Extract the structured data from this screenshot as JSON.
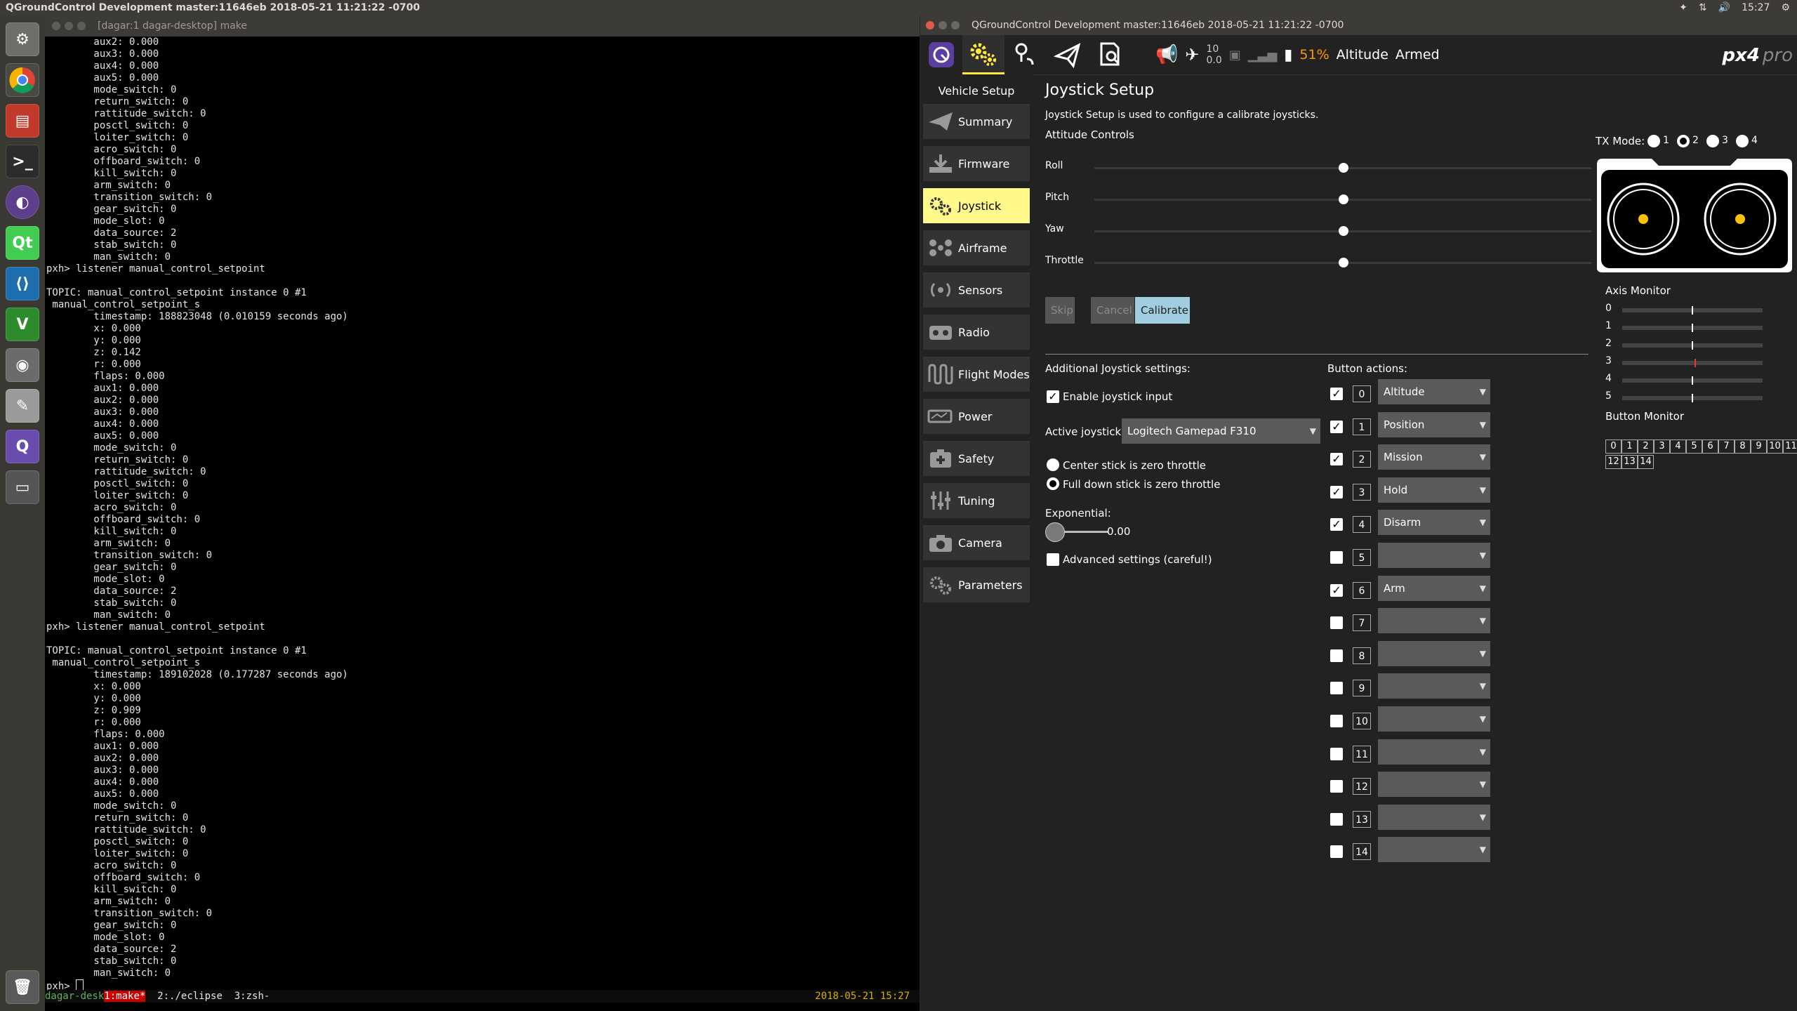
{
  "system_bar": {
    "title": "QGroundControl Development master:11646eb 2018-05-21 11:21:22 -0700",
    "clock": "15:27"
  },
  "launcher": {
    "icons": [
      "system-settings-icon",
      "chrome-icon",
      "files-icon",
      "terminal-icon",
      "eclipse-icon",
      "qt-creator-icon",
      "vscode-icon",
      "vim-icon",
      "camera-icon",
      "text-editor-icon",
      "qgroundcontrol-icon",
      "window-icon",
      "trash-icon"
    ]
  },
  "terminal": {
    "title": "[dagar:1 dagar-desktop] make",
    "lines": [
      "        aux2: 0.000",
      "        aux3: 0.000",
      "        aux4: 0.000",
      "        aux5: 0.000",
      "        mode_switch: 0",
      "        return_switch: 0",
      "        rattitude_switch: 0",
      "        posctl_switch: 0",
      "        loiter_switch: 0",
      "        acro_switch: 0",
      "        offboard_switch: 0",
      "        kill_switch: 0",
      "        arm_switch: 0",
      "        transition_switch: 0",
      "        gear_switch: 0",
      "        mode_slot: 0",
      "        data_source: 2",
      "        stab_switch: 0",
      "        man_switch: 0",
      "pxh> listener manual_control_setpoint",
      "",
      "TOPIC: manual_control_setpoint instance 0 #1",
      " manual_control_setpoint_s",
      "        timestamp: 188823048 (0.010159 seconds ago)",
      "        x: 0.000",
      "        y: 0.000",
      "        z: 0.142",
      "        r: 0.000",
      "        flaps: 0.000",
      "        aux1: 0.000",
      "        aux2: 0.000",
      "        aux3: 0.000",
      "        aux4: 0.000",
      "        aux5: 0.000",
      "        mode_switch: 0",
      "        return_switch: 0",
      "        rattitude_switch: 0",
      "        posctl_switch: 0",
      "        loiter_switch: 0",
      "        acro_switch: 0",
      "        offboard_switch: 0",
      "        kill_switch: 0",
      "        arm_switch: 0",
      "        transition_switch: 0",
      "        gear_switch: 0",
      "        mode_slot: 0",
      "        data_source: 2",
      "        stab_switch: 0",
      "        man_switch: 0",
      "pxh> listener manual_control_setpoint",
      "",
      "TOPIC: manual_control_setpoint instance 0 #1",
      " manual_control_setpoint_s",
      "        timestamp: 189102028 (0.177287 seconds ago)",
      "        x: 0.000",
      "        y: 0.000",
      "        z: 0.909",
      "        r: 0.000",
      "        flaps: 0.000",
      "        aux1: 0.000",
      "        aux2: 0.000",
      "        aux3: 0.000",
      "        aux4: 0.000",
      "        aux5: 0.000",
      "        mode_switch: 0",
      "        return_switch: 0",
      "        rattitude_switch: 0",
      "        posctl_switch: 0",
      "        loiter_switch: 0",
      "        acro_switch: 0",
      "        offboard_switch: 0",
      "        kill_switch: 0",
      "        arm_switch: 0",
      "        transition_switch: 0",
      "        gear_switch: 0",
      "        mode_slot: 0",
      "        data_source: 2",
      "        stab_switch: 0",
      "        man_switch: 0"
    ],
    "prompt": "pxh> ",
    "status": {
      "host": "dagar-desk",
      "window1": "1:make*",
      "window2": "2:./eclipse",
      "window3": "3:zsh-",
      "datetime": "2018-05-21 15:27"
    }
  },
  "qgc": {
    "title": "QGroundControl Development master:11646eb 2018-05-21 11:21:22 -0700",
    "toolbar": {
      "sat_count": "10",
      "hdop": "0.0",
      "battery": "51%",
      "flight_mode": "Altitude",
      "arm_state": "Armed",
      "logo": "px4",
      "logo_suffix": "pro"
    },
    "sidebar": {
      "header": "Vehicle Setup",
      "items": [
        {
          "label": "Summary"
        },
        {
          "label": "Firmware"
        },
        {
          "label": "Joystick"
        },
        {
          "label": "Airframe"
        },
        {
          "label": "Sensors"
        },
        {
          "label": "Radio"
        },
        {
          "label": "Flight Modes"
        },
        {
          "label": "Power"
        },
        {
          "label": "Safety"
        },
        {
          "label": "Tuning"
        },
        {
          "label": "Camera"
        },
        {
          "label": "Parameters"
        }
      ]
    },
    "joystick": {
      "title": "Joystick Setup",
      "description": "Joystick Setup is used to configure a calibrate joysticks.",
      "attitude_header": "Attitude Controls",
      "controls": [
        {
          "label": "Roll",
          "value": 0.5
        },
        {
          "label": "Pitch",
          "value": 0.5
        },
        {
          "label": "Yaw",
          "value": 0.5
        },
        {
          "label": "Throttle",
          "value": 0.5
        }
      ],
      "tx_mode_label": "TX Mode:",
      "tx_modes": [
        "1",
        "2",
        "3",
        "4"
      ],
      "tx_mode_selected": "2",
      "buttons": {
        "skip": "Skip",
        "cancel": "Cancel",
        "calibrate": "Calibrate"
      },
      "additional_header": "Additional Joystick settings:",
      "enable_label": "Enable joystick input",
      "active_label": "Active joystick:",
      "active_value": "Logitech Gamepad F310",
      "center_label": "Center stick is zero throttle",
      "fulldown_label": "Full down stick is zero throttle",
      "exponential_label": "Exponential:",
      "exponential_value": "0.00",
      "advanced_label": "Advanced settings (careful!)",
      "button_actions_header": "Button actions:",
      "button_actions": [
        {
          "num": "0",
          "checked": true,
          "action": "Altitude"
        },
        {
          "num": "1",
          "checked": true,
          "action": "Position"
        },
        {
          "num": "2",
          "checked": true,
          "action": "Mission"
        },
        {
          "num": "3",
          "checked": true,
          "action": "Hold"
        },
        {
          "num": "4",
          "checked": true,
          "action": "Disarm"
        },
        {
          "num": "5",
          "checked": false,
          "action": ""
        },
        {
          "num": "6",
          "checked": true,
          "action": "Arm"
        },
        {
          "num": "7",
          "checked": false,
          "action": ""
        },
        {
          "num": "8",
          "checked": false,
          "action": ""
        },
        {
          "num": "9",
          "checked": false,
          "action": ""
        },
        {
          "num": "10",
          "checked": false,
          "action": ""
        },
        {
          "num": "11",
          "checked": false,
          "action": ""
        },
        {
          "num": "12",
          "checked": false,
          "action": ""
        },
        {
          "num": "13",
          "checked": false,
          "action": ""
        },
        {
          "num": "14",
          "checked": false,
          "action": ""
        }
      ],
      "axis_monitor_header": "Axis Monitor",
      "axes": [
        {
          "num": "0",
          "value": 0.5
        },
        {
          "num": "1",
          "value": 0.5
        },
        {
          "num": "2",
          "value": 0.5
        },
        {
          "num": "3",
          "value": 0.52
        },
        {
          "num": "4",
          "value": 0.5
        },
        {
          "num": "5",
          "value": 0.5
        }
      ],
      "button_monitor_header": "Button Monitor",
      "monitor_buttons": [
        "0",
        "1",
        "2",
        "3",
        "4",
        "5",
        "6",
        "7",
        "8",
        "9",
        "10",
        "11",
        "12",
        "13",
        "14"
      ]
    }
  }
}
